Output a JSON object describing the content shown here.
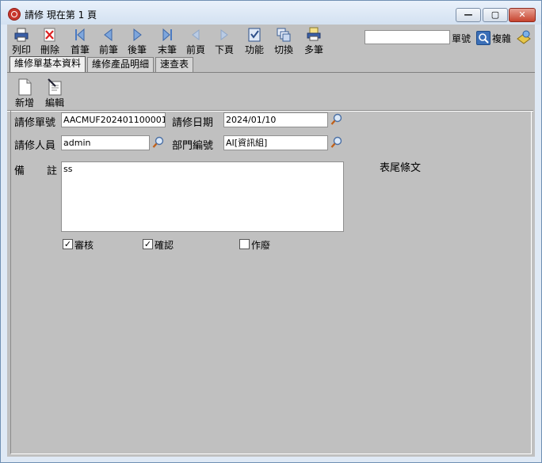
{
  "window": {
    "title": "請修 現在第 1 頁",
    "controls": {
      "minimize": "—",
      "maximize": "▢",
      "close": "✕"
    }
  },
  "toolbar": {
    "buttons": [
      {
        "label": "列印",
        "icon": "printer-icon"
      },
      {
        "label": "刪除",
        "icon": "delete-icon"
      },
      {
        "label": "首筆",
        "icon": "first-record-icon"
      },
      {
        "label": "前筆",
        "icon": "prev-record-icon"
      },
      {
        "label": "後筆",
        "icon": "next-record-icon"
      },
      {
        "label": "末筆",
        "icon": "last-record-icon"
      },
      {
        "label": "前頁",
        "icon": "prev-page-icon"
      },
      {
        "label": "下頁",
        "icon": "next-page-icon"
      },
      {
        "label": "功能",
        "icon": "function-icon"
      },
      {
        "label": "切換",
        "icon": "switch-icon"
      },
      {
        "label": "多筆",
        "icon": "multi-print-icon"
      }
    ],
    "search": {
      "value": "",
      "label": "單號",
      "complex_label": "複雜"
    }
  },
  "tabs": [
    {
      "label": "維修單基本資料",
      "active": true
    },
    {
      "label": "維修產品明細",
      "active": false
    },
    {
      "label": "速查表",
      "active": false
    }
  ],
  "subtoolbar": {
    "new_label": "新增",
    "edit_label": "編輯"
  },
  "form": {
    "order_no_label": "請修單號",
    "order_no_value": "AACMUF202401100001",
    "date_label": "請修日期",
    "date_value": "2024/01/10",
    "person_label": "請修人員",
    "person_value": "admin",
    "dept_label": "部門編號",
    "dept_value": "AI[資訊組]",
    "remark_label_1": "備",
    "remark_label_2": "註",
    "remark_value": "ss",
    "footer_text": "表尾條文",
    "checkboxes": [
      {
        "label": "審核",
        "checked": true
      },
      {
        "label": "確認",
        "checked": true
      },
      {
        "label": "作廢",
        "checked": false
      }
    ]
  },
  "colors": {
    "client_bg": "#c0c0c0",
    "title_bg": "#dfe9f5",
    "close_button": "#c7432e"
  }
}
